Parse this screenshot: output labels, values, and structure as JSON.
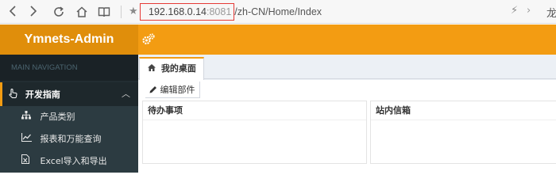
{
  "browser": {
    "url_host": "192.168.0.14",
    "url_port": ":8081",
    "url_path": "/zh-CN/Home/Index",
    "profile_char": "龙"
  },
  "app": {
    "brand": "Ymnets-Admin"
  },
  "sidebar": {
    "header": "MAIN NAVIGATION",
    "menu": {
      "label": "开发指南",
      "items": [
        {
          "label": "产品类别",
          "icon": "sitemap-icon"
        },
        {
          "label": "报表和万能查询",
          "icon": "line-chart-icon"
        },
        {
          "label": "Excel导入和导出",
          "icon": "file-excel-icon"
        }
      ]
    }
  },
  "content": {
    "tab_label": "我的桌面",
    "edit_button": "编辑部件",
    "boxes": [
      {
        "title": "待办事项"
      },
      {
        "title": "站内信箱"
      }
    ]
  },
  "colors": {
    "accent": "#f39c12",
    "brand_bg": "#e08e0b",
    "sidebar_bg": "#222d32",
    "sidebar_header_bg": "#1a2226",
    "url_highlight": "#e53935"
  }
}
